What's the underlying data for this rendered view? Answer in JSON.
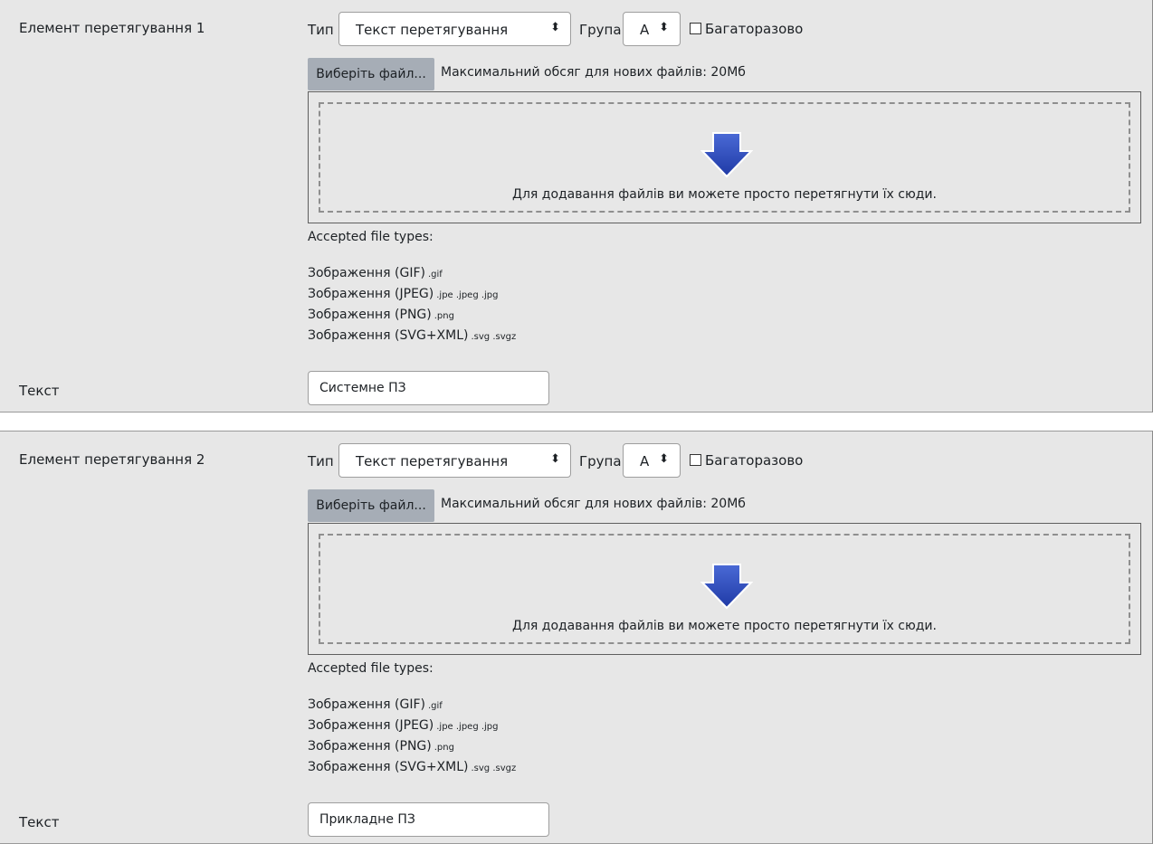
{
  "items": [
    {
      "title": "Елемент перетягування 1",
      "type_label": "Тип",
      "type_value": "Текст перетягування",
      "group_label": "Група",
      "group_value": "A",
      "infinite_label": "Багаторазово",
      "choose_file_label": "Виберіть файл...",
      "max_size_text": "Максимальний обсяг для нових файлів: 20Мб",
      "drop_text": "Для додавання файлів ви можете просто перетягнути їх сюди.",
      "accepted_label": "Accepted file types:",
      "file_types": [
        {
          "name": "Зображення (GIF)",
          "ext": ".gif"
        },
        {
          "name": "Зображення (JPEG)",
          "ext": ".jpe .jpeg .jpg"
        },
        {
          "name": "Зображення (PNG)",
          "ext": ".png"
        },
        {
          "name": "Зображення (SVG+XML)",
          "ext": ".svg .svgz"
        }
      ],
      "text_label": "Текст",
      "text_value": "Системне ПЗ"
    },
    {
      "title": "Елемент перетягування 2",
      "type_label": "Тип",
      "type_value": "Текст перетягування",
      "group_label": "Група",
      "group_value": "A",
      "infinite_label": "Багаторазово",
      "choose_file_label": "Виберіть файл...",
      "max_size_text": "Максимальний обсяг для нових файлів: 20Мб",
      "drop_text": "Для додавання файлів ви можете просто перетягнути їх сюди.",
      "accepted_label": "Accepted file types:",
      "file_types": [
        {
          "name": "Зображення (GIF)",
          "ext": ".gif"
        },
        {
          "name": "Зображення (JPEG)",
          "ext": ".jpe .jpeg .jpg"
        },
        {
          "name": "Зображення (PNG)",
          "ext": ".png"
        },
        {
          "name": "Зображення (SVG+XML)",
          "ext": ".svg .svgz"
        }
      ],
      "text_label": "Текст",
      "text_value": "Прикладне ПЗ"
    }
  ],
  "icons": {
    "select_arrow": "up-down-caret-icon",
    "drop_arrow": "down-arrow-icon"
  },
  "colors": {
    "panel_bg": "#e7e7e7",
    "button_bg": "#a6adb6",
    "arrow_blue": "#2f4fbf"
  }
}
